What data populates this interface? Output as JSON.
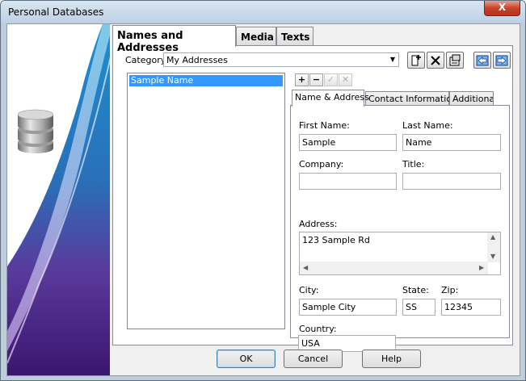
{
  "window": {
    "title": "Personal Databases",
    "close_glyph": "X"
  },
  "main_tabs": [
    {
      "label": "Names and Addresses",
      "active": true
    },
    {
      "label": "Media",
      "active": false
    },
    {
      "label": "Texts",
      "active": false
    }
  ],
  "category": {
    "label": "Category:",
    "value": "My Addresses"
  },
  "name_list": {
    "items": [
      "Sample Name"
    ],
    "selected": "Sample Name"
  },
  "list_buttons": {
    "add": "+",
    "remove": "−"
  },
  "sub_tabs": [
    {
      "label": "Name & Address",
      "active": true
    },
    {
      "label": "Contact Information",
      "active": false
    },
    {
      "label": "Additional",
      "active": false
    }
  ],
  "form": {
    "first_name": {
      "label": "First Name:",
      "value": "Sample"
    },
    "last_name": {
      "label": "Last Name:",
      "value": "Name"
    },
    "company": {
      "label": "Company:",
      "value": ""
    },
    "title": {
      "label": "Title:",
      "value": ""
    },
    "address": {
      "label": "Address:",
      "value": "123 Sample Rd"
    },
    "city": {
      "label": "City:",
      "value": "Sample City"
    },
    "state": {
      "label": "State:",
      "value": "SS"
    },
    "zip": {
      "label": "Zip:",
      "value": "12345"
    },
    "country": {
      "label": "Country:",
      "value": "USA"
    }
  },
  "buttons": {
    "ok": "OK",
    "cancel": "Cancel",
    "help": "Help"
  },
  "colors": {
    "selection": "#3399ff",
    "frame_border": "#bfcddb"
  }
}
